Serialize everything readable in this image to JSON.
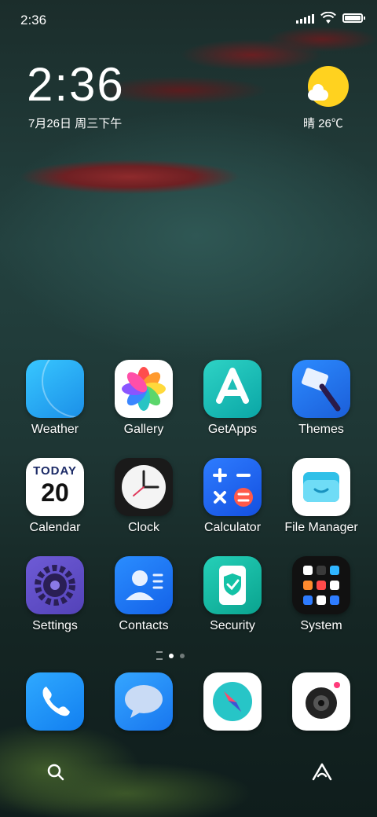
{
  "status": {
    "time": "2:36"
  },
  "widget": {
    "time": "2:36",
    "date": "7月26日 周三下午",
    "weather": "晴 26℃"
  },
  "apps": [
    {
      "label": "Weather"
    },
    {
      "label": "Gallery"
    },
    {
      "label": "GetApps"
    },
    {
      "label": "Themes"
    },
    {
      "label": "Calendar"
    },
    {
      "label": "Clock"
    },
    {
      "label": "Calculator"
    },
    {
      "label": "File Manager"
    },
    {
      "label": "Settings"
    },
    {
      "label": "Contacts"
    },
    {
      "label": "Security"
    },
    {
      "label": "System"
    }
  ],
  "calendar_icon": {
    "day_word": "TODAY",
    "day_number": "20"
  },
  "dock": [
    {
      "icon": "phone-icon"
    },
    {
      "icon": "messages-icon"
    },
    {
      "icon": "browser-icon"
    },
    {
      "icon": "camera-icon"
    }
  ],
  "page_indicator": {
    "current": 1,
    "count": 2
  },
  "bottom_bar": {
    "left_icon": "search-icon",
    "right_icon": "app-vault-icon"
  },
  "colors": {
    "sun": "#ffd21f",
    "accent_blue": "#1b8fe8",
    "security_green": "#0aa38f"
  }
}
